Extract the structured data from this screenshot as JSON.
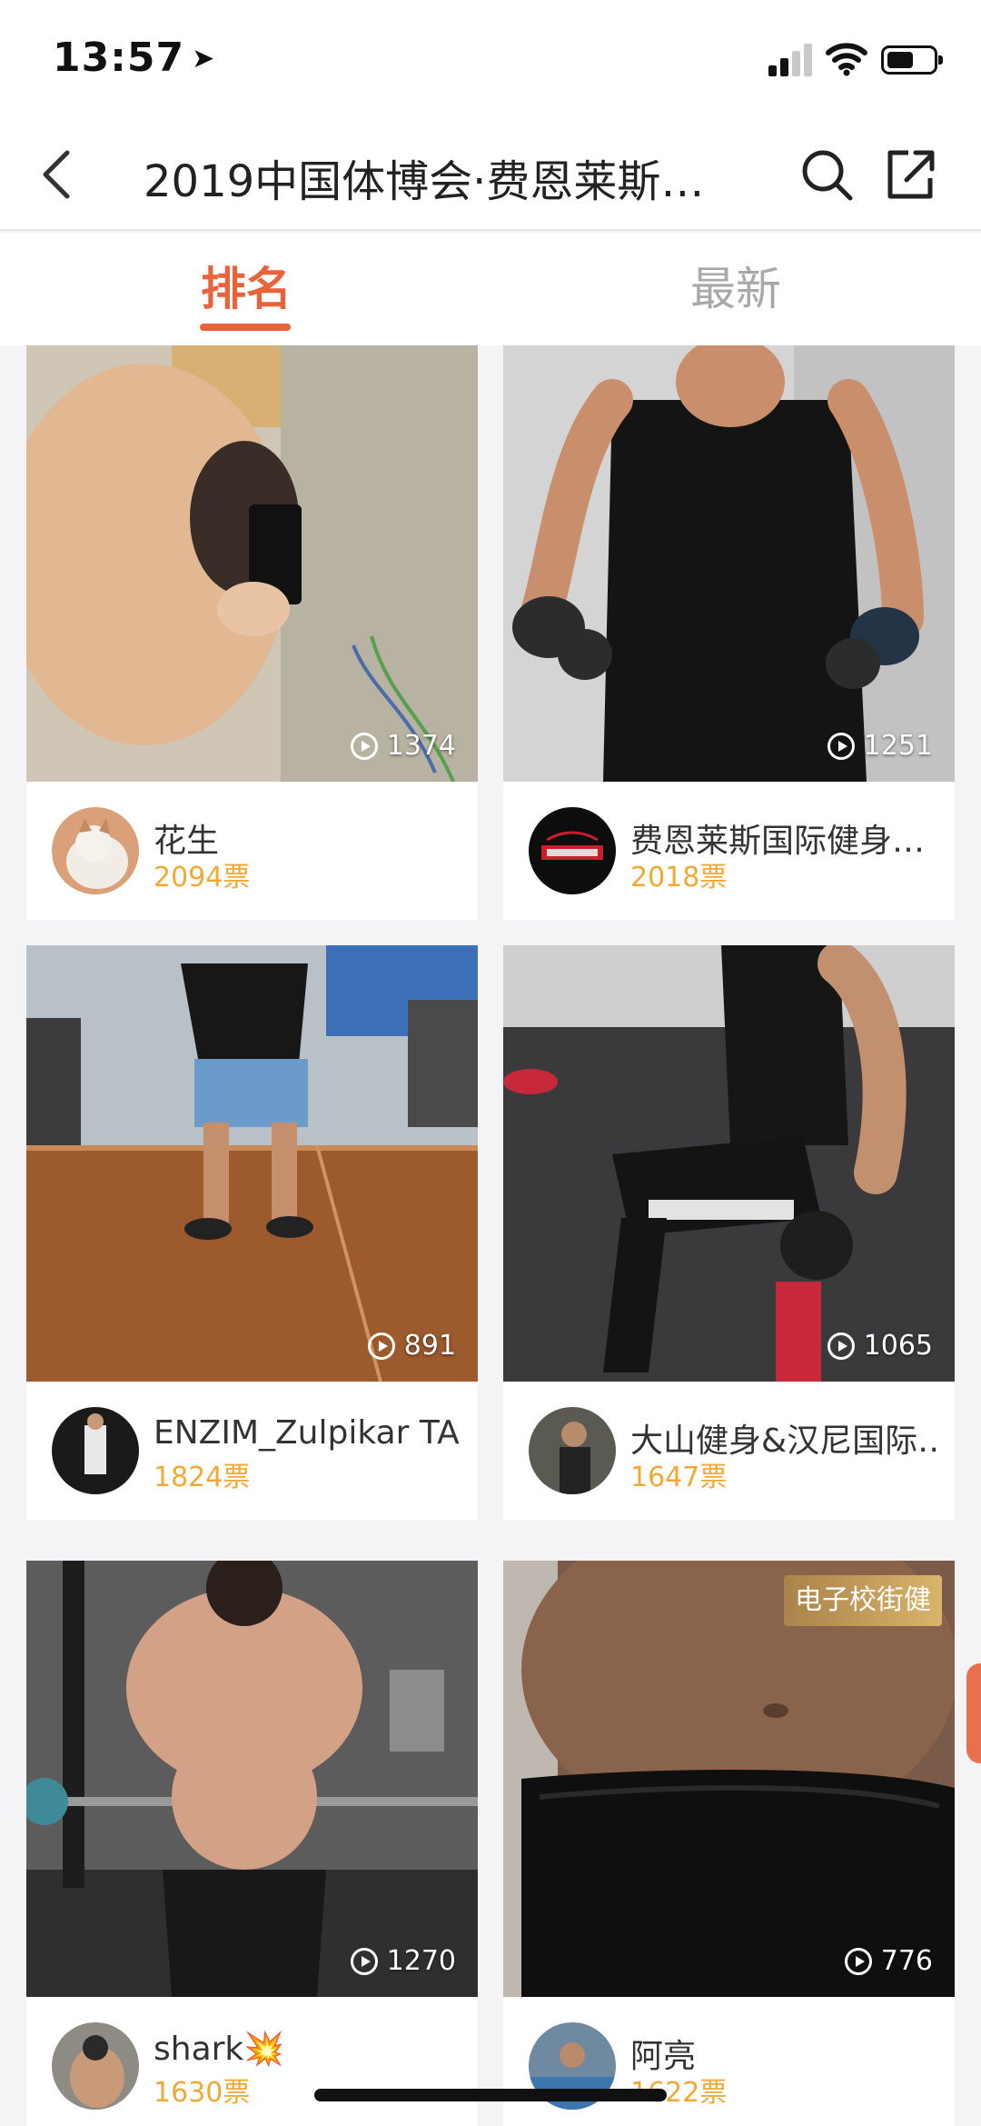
{
  "status": {
    "time": "13:57",
    "location_icon": "location-arrow-icon"
  },
  "nav": {
    "back_icon": "chevron-left-icon",
    "title": "2019中国体博会·费恩莱斯…",
    "search_icon": "search-icon",
    "share_icon": "share-icon"
  },
  "tabs": [
    {
      "label": "排名",
      "active": true
    },
    {
      "label": "最新",
      "active": false
    }
  ],
  "cards": [
    {
      "plays": "1374",
      "name": "花生",
      "votes": "2094票"
    },
    {
      "plays": "1251",
      "name": "费恩莱斯国际健身…",
      "votes": "2018票"
    },
    {
      "plays": "891",
      "name": "ENZIM_Zulpikar TA…",
      "votes": "1824票"
    },
    {
      "plays": "1065",
      "name": "大山健身&汉尼国际…",
      "votes": "1647票"
    },
    {
      "plays": "1270",
      "name": "shark💥",
      "votes": "1630票"
    },
    {
      "plays": "776",
      "name": "阿亮",
      "votes": "1622票",
      "badge": "电子校街健"
    }
  ],
  "colors": {
    "accent": "#e8623c",
    "votes": "#f0a935",
    "inactive_tab": "#a8a8a8"
  }
}
